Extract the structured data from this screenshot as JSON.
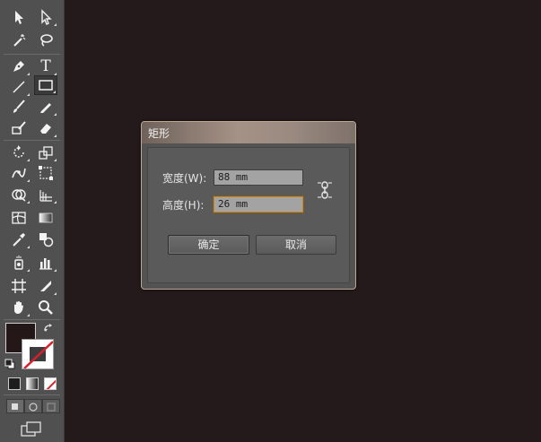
{
  "toolbar": {
    "tools": [
      {
        "name": "selection-tool-icon"
      },
      {
        "name": "direct-selection-tool-icon"
      },
      {
        "name": "magic-wand-tool-icon"
      },
      {
        "name": "lasso-tool-icon"
      },
      {
        "name": "pen-tool-icon"
      },
      {
        "name": "type-tool-icon"
      },
      {
        "name": "line-segment-tool-icon"
      },
      {
        "name": "rectangle-tool-icon"
      },
      {
        "name": "paintbrush-tool-icon"
      },
      {
        "name": "pencil-tool-icon"
      },
      {
        "name": "blob-brush-tool-icon"
      },
      {
        "name": "eraser-tool-icon"
      },
      {
        "name": "rotate-tool-icon"
      },
      {
        "name": "scale-tool-icon"
      },
      {
        "name": "width-tool-icon"
      },
      {
        "name": "free-transform-tool-icon"
      },
      {
        "name": "shape-builder-tool-icon"
      },
      {
        "name": "perspective-grid-tool-icon"
      },
      {
        "name": "mesh-tool-icon"
      },
      {
        "name": "gradient-tool-icon"
      },
      {
        "name": "eyedropper-tool-icon"
      },
      {
        "name": "blend-tool-icon"
      },
      {
        "name": "symbol-sprayer-tool-icon"
      },
      {
        "name": "column-graph-tool-icon"
      },
      {
        "name": "artboard-tool-icon"
      },
      {
        "name": "slice-tool-icon"
      },
      {
        "name": "hand-tool-icon"
      },
      {
        "name": "zoom-tool-icon"
      }
    ],
    "type_tool_glyph": "T",
    "fill_color": "#231718",
    "stroke_color": "none"
  },
  "dialog": {
    "title": "矩形",
    "width_label": "宽度(W):",
    "width_value": "88 mm",
    "height_label": "高度(H):",
    "height_value": "26 mm",
    "ok_label": "确定",
    "cancel_label": "取消",
    "constrain_icon": "link-proportions-icon"
  },
  "colors": {
    "canvas": "#241a1b",
    "toolbar": "#505050",
    "focus_border": "#c5882a"
  }
}
